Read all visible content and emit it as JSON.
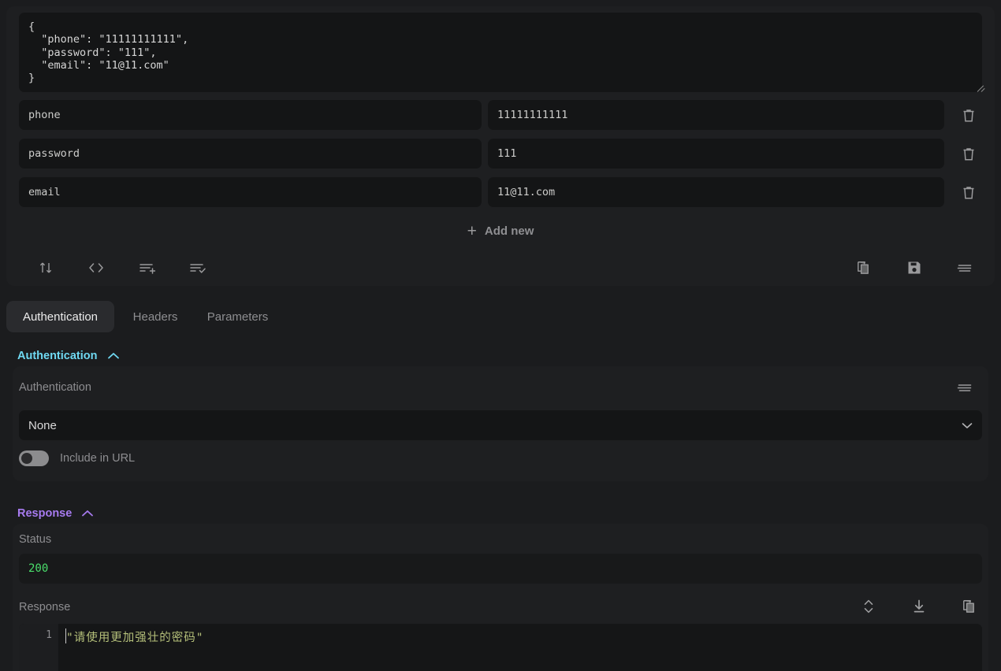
{
  "colors": {
    "page_bg": "#1b1c1e",
    "panel_bg": "#1e1f21",
    "field_bg": "#141516",
    "auth_accent": "#6fd9f2",
    "response_accent": "#a77bf0",
    "status_ok": "#4ade6b",
    "code_string": "#b5c07a",
    "muted_text": "#8d8d90",
    "icon": "#9a9a9c"
  },
  "request_body": {
    "json_text": "{\n  \"phone\": \"11111111111\",\n  \"password\": \"111\",\n  \"email\": \"11@11.com\"\n}",
    "rows": [
      {
        "key": "phone",
        "value": "11111111111",
        "delete_icon": "trash-icon"
      },
      {
        "key": "password",
        "value": "111",
        "delete_icon": "trash-icon"
      },
      {
        "key": "email",
        "value": "11@11.com",
        "delete_icon": "trash-icon"
      }
    ],
    "add_new_label": "Add new",
    "add_new_icon": "plus-icon",
    "toolbar_left": [
      {
        "icon": "sort-arrows-icon"
      },
      {
        "icon": "code-brackets-icon"
      },
      {
        "icon": "list-add-icon"
      },
      {
        "icon": "list-check-icon"
      }
    ],
    "toolbar_right": [
      {
        "icon": "copy-icon"
      },
      {
        "icon": "save-floppy-icon"
      },
      {
        "icon": "align-lines-icon"
      }
    ],
    "resize_handle_icon": "resize-grip-icon"
  },
  "tabs": [
    {
      "label": "Authentication",
      "active": true
    },
    {
      "label": "Headers",
      "active": false
    },
    {
      "label": "Parameters",
      "active": false
    }
  ],
  "authentication": {
    "section_title": "Authentication",
    "section_chevron": "chevron-up-icon",
    "field_label": "Authentication",
    "field_menu_icon": "align-lines-icon",
    "selected_option": "None",
    "select_chevron": "chevron-down-icon",
    "toggle": {
      "label": "Include in URL",
      "state": "off"
    }
  },
  "response": {
    "section_title": "Response",
    "section_chevron": "chevron-up-icon",
    "status_label": "Status",
    "status_value": "200",
    "body_label": "Response",
    "tools": [
      {
        "icon": "expand-collapse-icon"
      },
      {
        "icon": "download-icon"
      },
      {
        "icon": "copy-icon"
      }
    ],
    "code": {
      "line_number": "1",
      "text": "\"请使用更加强壮的密码\""
    }
  }
}
